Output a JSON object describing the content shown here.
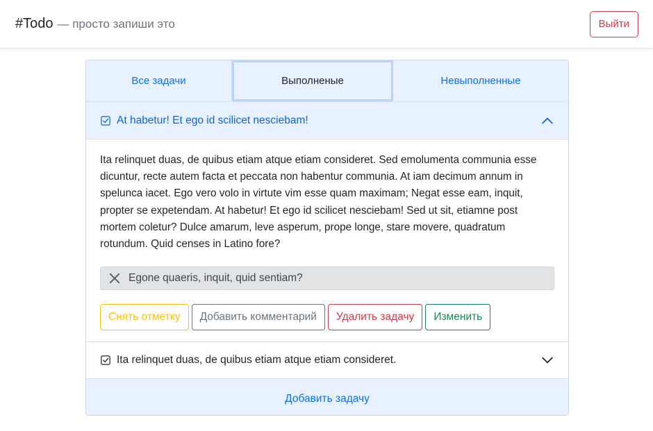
{
  "header": {
    "brand": "#Todo",
    "tagline": "— просто запиши это",
    "logout_label": "Выйти"
  },
  "tabs": [
    {
      "label": "Все задачи",
      "active": false
    },
    {
      "label": "Выполненые",
      "active": true
    },
    {
      "label": "Невыполненные",
      "active": false
    }
  ],
  "tasks": [
    {
      "title": "At habetur! Et ego id scilicet nesciebam!",
      "expanded": true,
      "completed_icon": "check-square-icon",
      "description": "Ita relinquet duas, de quibus etiam atque etiam consideret. Sed emolumenta communia esse dicuntur, recte autem facta et peccata non habentur communia. At iam decimum annum in spelunca iacet. Ego vero volo in virtute vim esse quam maximam; Negat esse eam, inquit, propter se expetendam. At habetur! Et ego id scilicet nesciebam! Sed ut sit, etiamne post mortem coletur? Dulce amarum, leve asperum, prope longe, stare movere, quadratum rotundum. Quid censes in Latino fore?",
      "comment": "Egone quaeris, inquit, quid sentiam?",
      "actions": {
        "unmark": "Снять отметку",
        "add_comment": "Добавить комментарий",
        "delete": "Удалить задачу",
        "edit": "Изменить"
      }
    },
    {
      "title": "Ita relinquet duas, de quibus etiam atque etiam consideret.",
      "expanded": false,
      "completed_icon": "check-square-icon"
    }
  ],
  "footer": {
    "add_task_label": "Добавить задачу"
  },
  "colors": {
    "primary": "#0d6efd",
    "danger": "#dc3545",
    "warning": "#ffc107",
    "success": "#198754",
    "secondary": "#6c757d",
    "accordion_active_bg": "#e7f1ff"
  }
}
